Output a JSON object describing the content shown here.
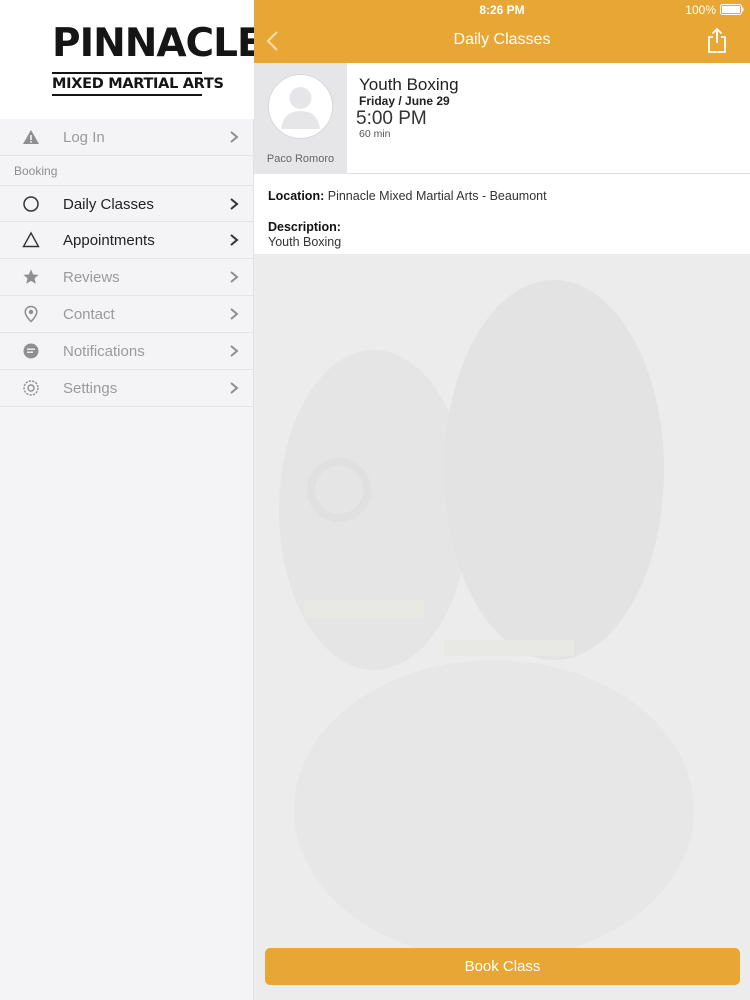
{
  "logo": {
    "line1": "PINNACLE",
    "line2": "MIXED MARTIAL ARTS"
  },
  "sidebar": {
    "login": {
      "label": "Log In",
      "icon": "warning-icon"
    },
    "section_label": "Booking",
    "items": [
      {
        "label": "Daily Classes",
        "icon": "circle-icon",
        "active": true
      },
      {
        "label": "Appointments",
        "icon": "triangle-icon",
        "active": true
      },
      {
        "label": "Reviews",
        "icon": "star-icon",
        "active": false
      },
      {
        "label": "Contact",
        "icon": "map-pin-icon",
        "active": false
      },
      {
        "label": "Notifications",
        "icon": "chat-bubble-icon",
        "active": false
      },
      {
        "label": "Settings",
        "icon": "gear-icon",
        "active": false
      }
    ]
  },
  "status_bar": {
    "time": "8:26 PM",
    "battery": "100%"
  },
  "header": {
    "title": "Daily Classes"
  },
  "class_card": {
    "instructor": "Paco Romoro",
    "title": "Youth Boxing",
    "date": "Friday / June 29",
    "time": "5:00 PM",
    "duration": "60 min"
  },
  "details": {
    "location_label": "Location:",
    "location_value": "Pinnacle Mixed Martial Arts - Beaumont",
    "description_label": "Description:",
    "description_value": "Youth Boxing"
  },
  "book_button": {
    "label": "Book Class"
  },
  "colors": {
    "accent": "#e8a635",
    "sidebar_bg": "#f4f4f6"
  }
}
